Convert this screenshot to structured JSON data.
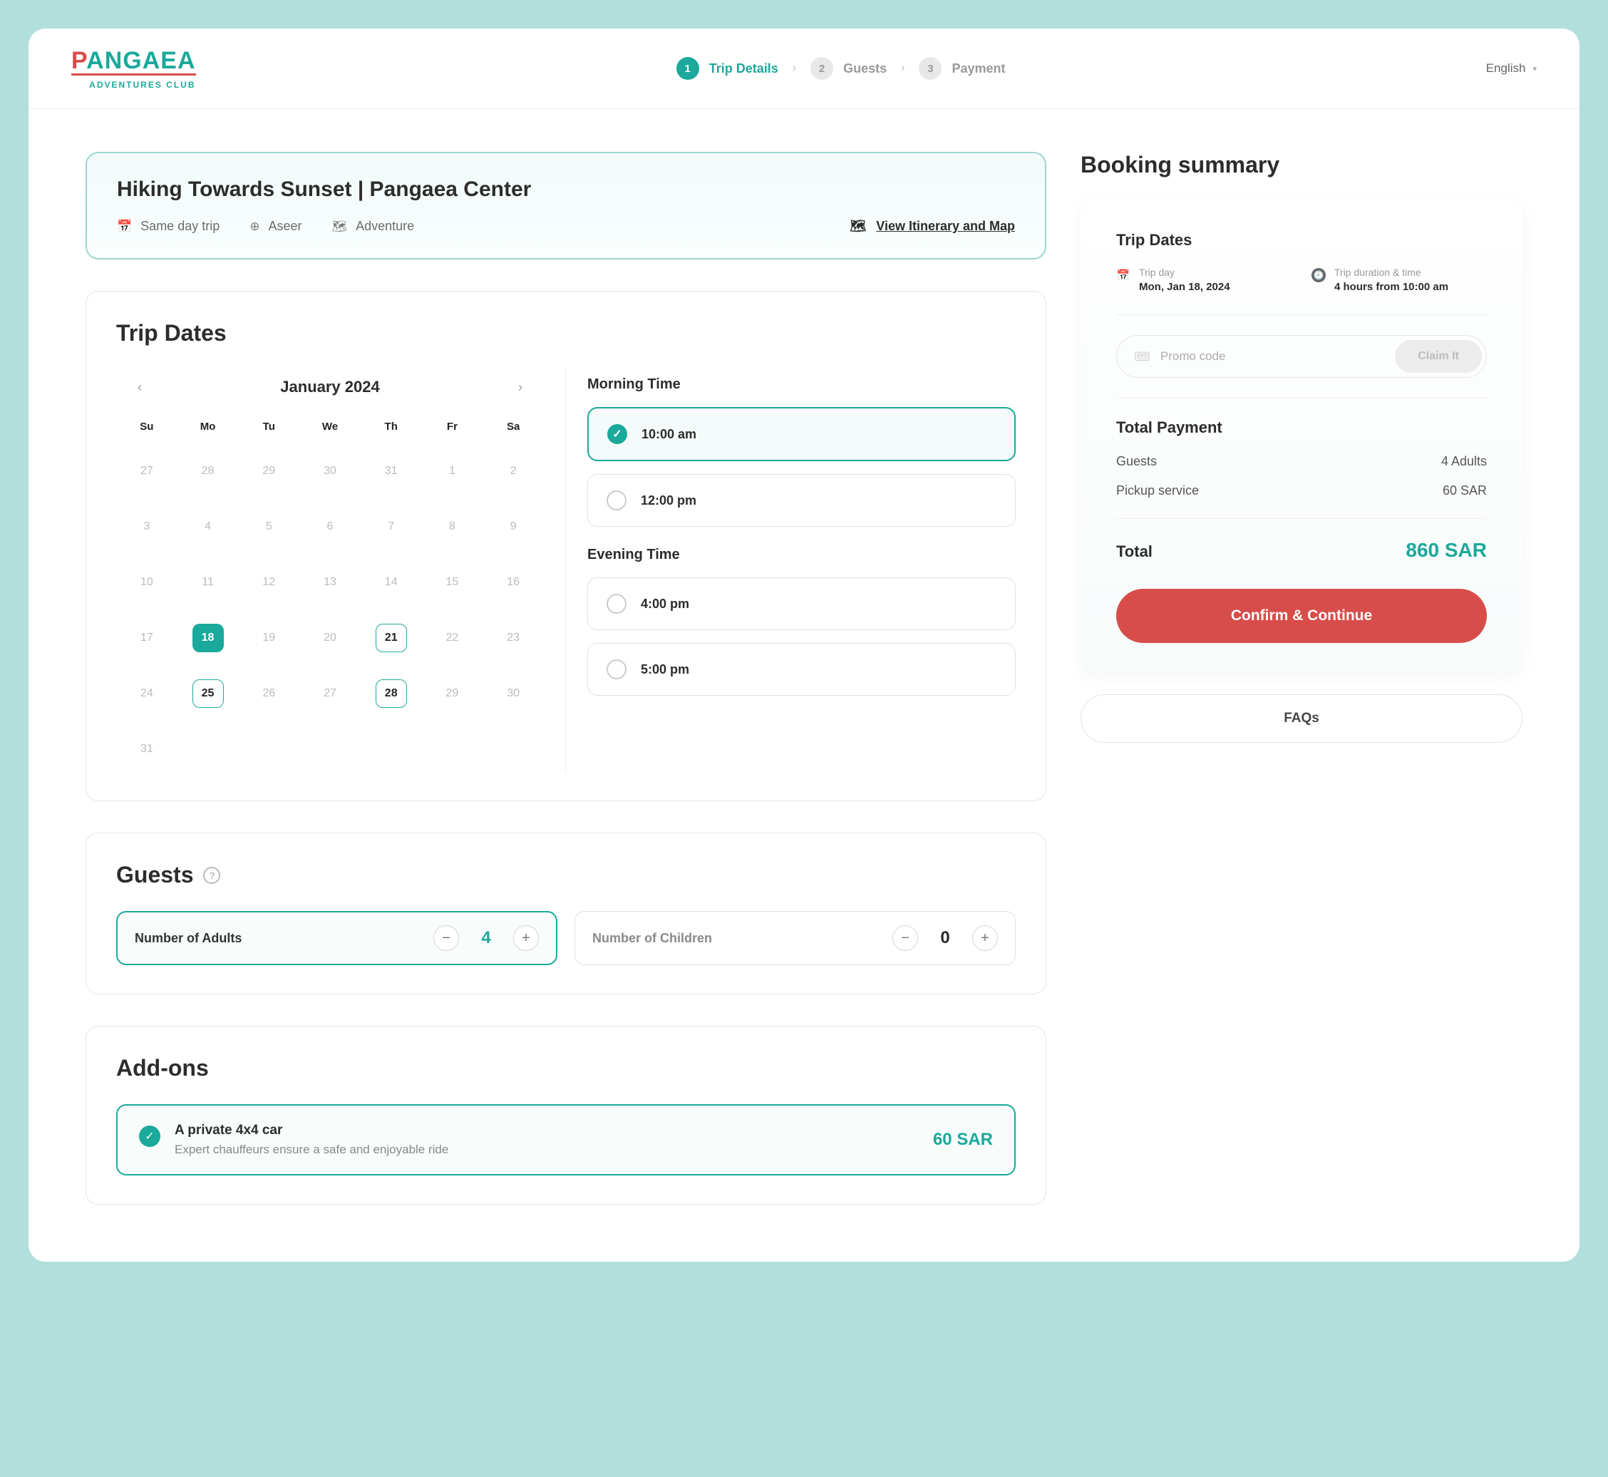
{
  "header": {
    "logo_text": "PANGAEA",
    "logo_tagline": "ADVENTURES CLUB",
    "steps": [
      {
        "num": "1",
        "label": "Trip Details",
        "state": "active"
      },
      {
        "num": "2",
        "label": "Guests",
        "state": "inactive"
      },
      {
        "num": "3",
        "label": "Payment",
        "state": "inactive"
      }
    ],
    "language": "English"
  },
  "trip": {
    "title": "Hiking Towards Sunset | Pangaea Center",
    "meta": {
      "duration": "Same day trip",
      "region": "Aseer",
      "category": "Adventure"
    },
    "itinerary_link": "View Itinerary and Map"
  },
  "dates": {
    "section_title": "Trip Dates",
    "calendar": {
      "month": "January 2024",
      "dow": [
        "Su",
        "Mo",
        "Tu",
        "We",
        "Th",
        "Fr",
        "Sa"
      ],
      "weeks": [
        [
          {
            "d": "27"
          },
          {
            "d": "28"
          },
          {
            "d": "29"
          },
          {
            "d": "30"
          },
          {
            "d": "31"
          },
          {
            "d": "1"
          },
          {
            "d": "2"
          }
        ],
        [
          {
            "d": "3"
          },
          {
            "d": "4"
          },
          {
            "d": "5"
          },
          {
            "d": "6"
          },
          {
            "d": "7"
          },
          {
            "d": "8"
          },
          {
            "d": "9"
          }
        ],
        [
          {
            "d": "10"
          },
          {
            "d": "11"
          },
          {
            "d": "12"
          },
          {
            "d": "13"
          },
          {
            "d": "14"
          },
          {
            "d": "15"
          },
          {
            "d": "16"
          }
        ],
        [
          {
            "d": "17"
          },
          {
            "d": "18",
            "s": "selected"
          },
          {
            "d": "19"
          },
          {
            "d": "20"
          },
          {
            "d": "21",
            "s": "outlined"
          },
          {
            "d": "22"
          },
          {
            "d": "23"
          }
        ],
        [
          {
            "d": "24"
          },
          {
            "d": "25",
            "s": "outlined"
          },
          {
            "d": "26"
          },
          {
            "d": "27"
          },
          {
            "d": "28",
            "s": "outlined"
          },
          {
            "d": "29"
          },
          {
            "d": "30"
          }
        ],
        [
          {
            "d": "31"
          },
          {
            "d": ""
          },
          {
            "d": ""
          },
          {
            "d": ""
          },
          {
            "d": ""
          },
          {
            "d": ""
          },
          {
            "d": ""
          }
        ]
      ]
    },
    "morning_title": "Morning Time",
    "morning_options": [
      {
        "label": "10:00 am",
        "selected": true
      },
      {
        "label": "12:00 pm",
        "selected": false
      }
    ],
    "evening_title": "Evening Time",
    "evening_options": [
      {
        "label": "4:00 pm",
        "selected": false
      },
      {
        "label": "5:00 pm",
        "selected": false
      }
    ]
  },
  "guests": {
    "section_title": "Guests",
    "adults_label": "Number of Adults",
    "adults_value": "4",
    "children_label": "Number of Children",
    "children_value": "0"
  },
  "addons": {
    "section_title": "Add-ons",
    "items": [
      {
        "title": "A private 4x4 car",
        "desc": "Expert chauffeurs ensure a safe and enjoyable ride",
        "price": "60 SAR",
        "selected": true
      }
    ]
  },
  "summary": {
    "title": "Booking summary",
    "dates_title": "Trip Dates",
    "trip_day_label": "Trip day",
    "trip_day_value": "Mon, Jan 18, 2024",
    "duration_label": "Trip duration & time",
    "duration_value": "4 hours from 10:00 am",
    "promo_placeholder": "Promo code",
    "promo_button": "Claim It",
    "total_title": "Total Payment",
    "line_guests_label": "Guests",
    "line_guests_value": "4 Adults",
    "line_pickup_label": "Pickup service",
    "line_pickup_value": "60 SAR",
    "total_label": "Total",
    "total_value": "860 SAR",
    "confirm_label": "Confirm & Continue",
    "faq_label": "FAQs"
  }
}
